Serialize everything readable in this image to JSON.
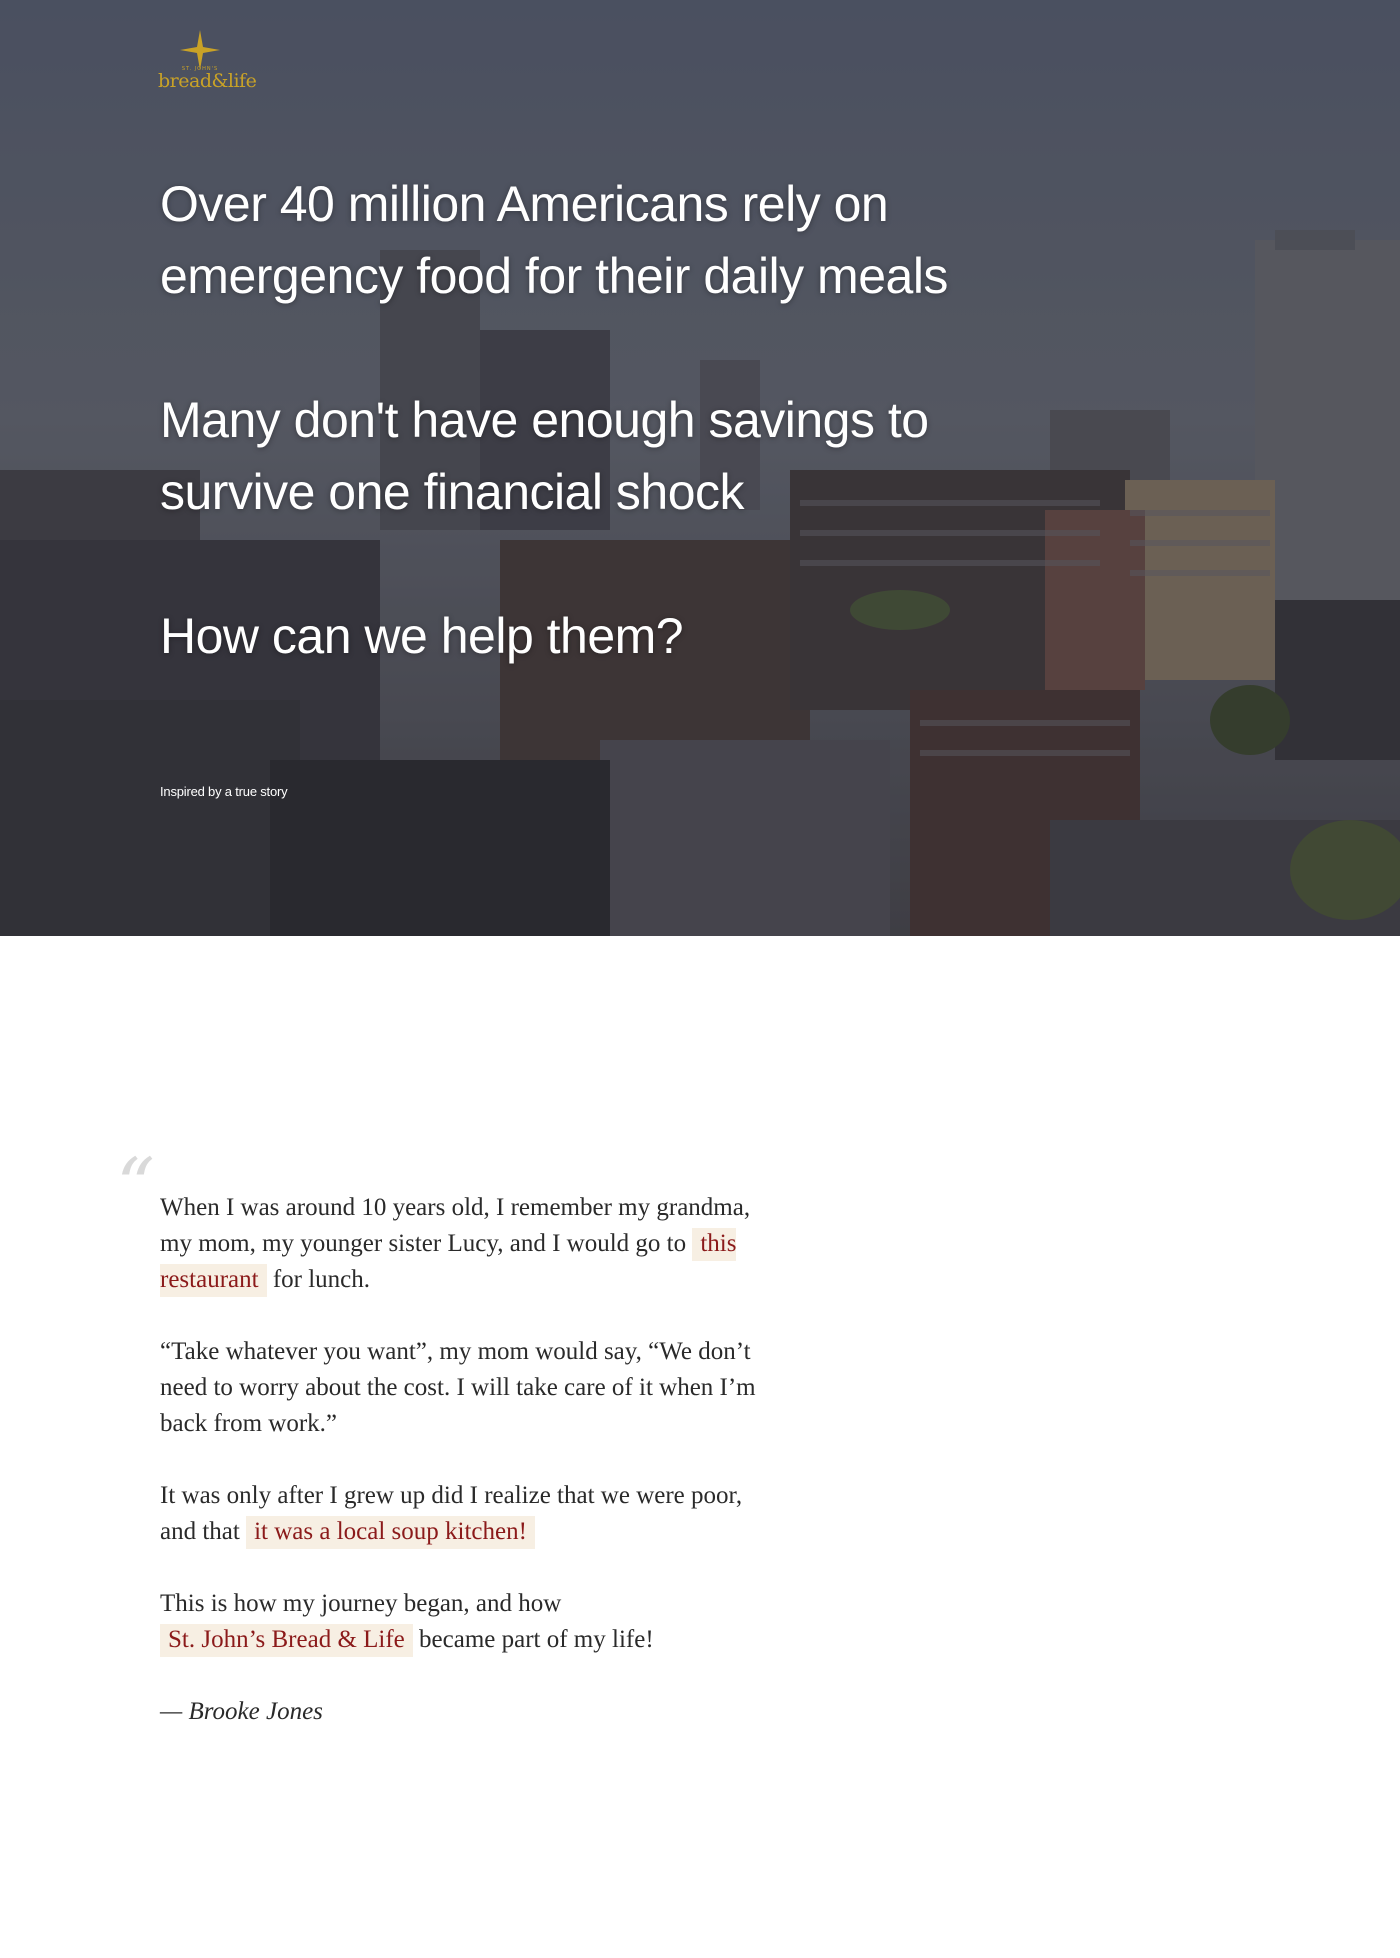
{
  "brand": {
    "name": "bread&life",
    "tagline": "ST. JOHN'S",
    "accent_color": "#c9a227",
    "logo_icon": "star-cross-icon"
  },
  "hero": {
    "headlines": [
      "Over 40 million Americans rely on emergency food for their daily meals",
      "Many don't have enough savings to survive one financial shock",
      "How can we help them?"
    ],
    "caption": "Inspired by a true story",
    "background": "city-rooftops-photo"
  },
  "story": {
    "quote_icon": "quote-mark-icon",
    "paragraphs": [
      {
        "before": "When I was around 10 years old, I remember my grandma, my mom, my younger sister Lucy, and I would go to ",
        "link": "this restaurant",
        "after": " for lunch."
      },
      {
        "text": "“Take whatever you want”, my mom would say, “We don’t need to worry about the cost. I will take care of it when I’m back from work.”"
      },
      {
        "before": "It was only after I grew up did I realize that we were poor, and that ",
        "link": "it was a local soup kitchen!",
        "after": ""
      },
      {
        "before": "This is how my journey began, and how ",
        "link": "St. John’s Bread & Life",
        "after": " became part of my life!"
      }
    ],
    "signature": "— Brooke Jones",
    "highlight_bg": "#f7efe3",
    "highlight_color": "#8b1a1a"
  }
}
